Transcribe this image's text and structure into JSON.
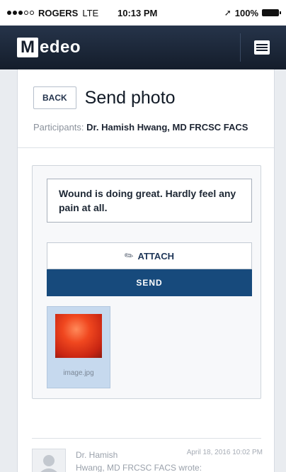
{
  "status_bar": {
    "carrier": "ROGERS",
    "network": "LTE",
    "time": "10:13 PM",
    "battery": "100%"
  },
  "app": {
    "logo_initial": "M",
    "logo_rest": "edeo"
  },
  "page": {
    "back_label": "BACK",
    "title": "Send photo",
    "participants_label": "Participants:",
    "participants_value": "Dr. Hamish Hwang, MD FRCSC FACS"
  },
  "composer": {
    "message_text": "Wound is doing great. Hardly feel any pain at all.",
    "attach_label": "ATTACH",
    "send_label": "SEND",
    "attachment_name": "image.jpg"
  },
  "thread": {
    "sender": "Dr. Hamish",
    "date": "April 18, 2016 10:02 PM",
    "sender_line2": "Hwang, MD FRCSC FACS wrote:"
  },
  "icons": {
    "menu": "hamburger-icon",
    "attach": "paperclip-icon",
    "location": "location-arrow-icon",
    "battery": "battery-icon",
    "avatar": "user-avatar-icon"
  }
}
